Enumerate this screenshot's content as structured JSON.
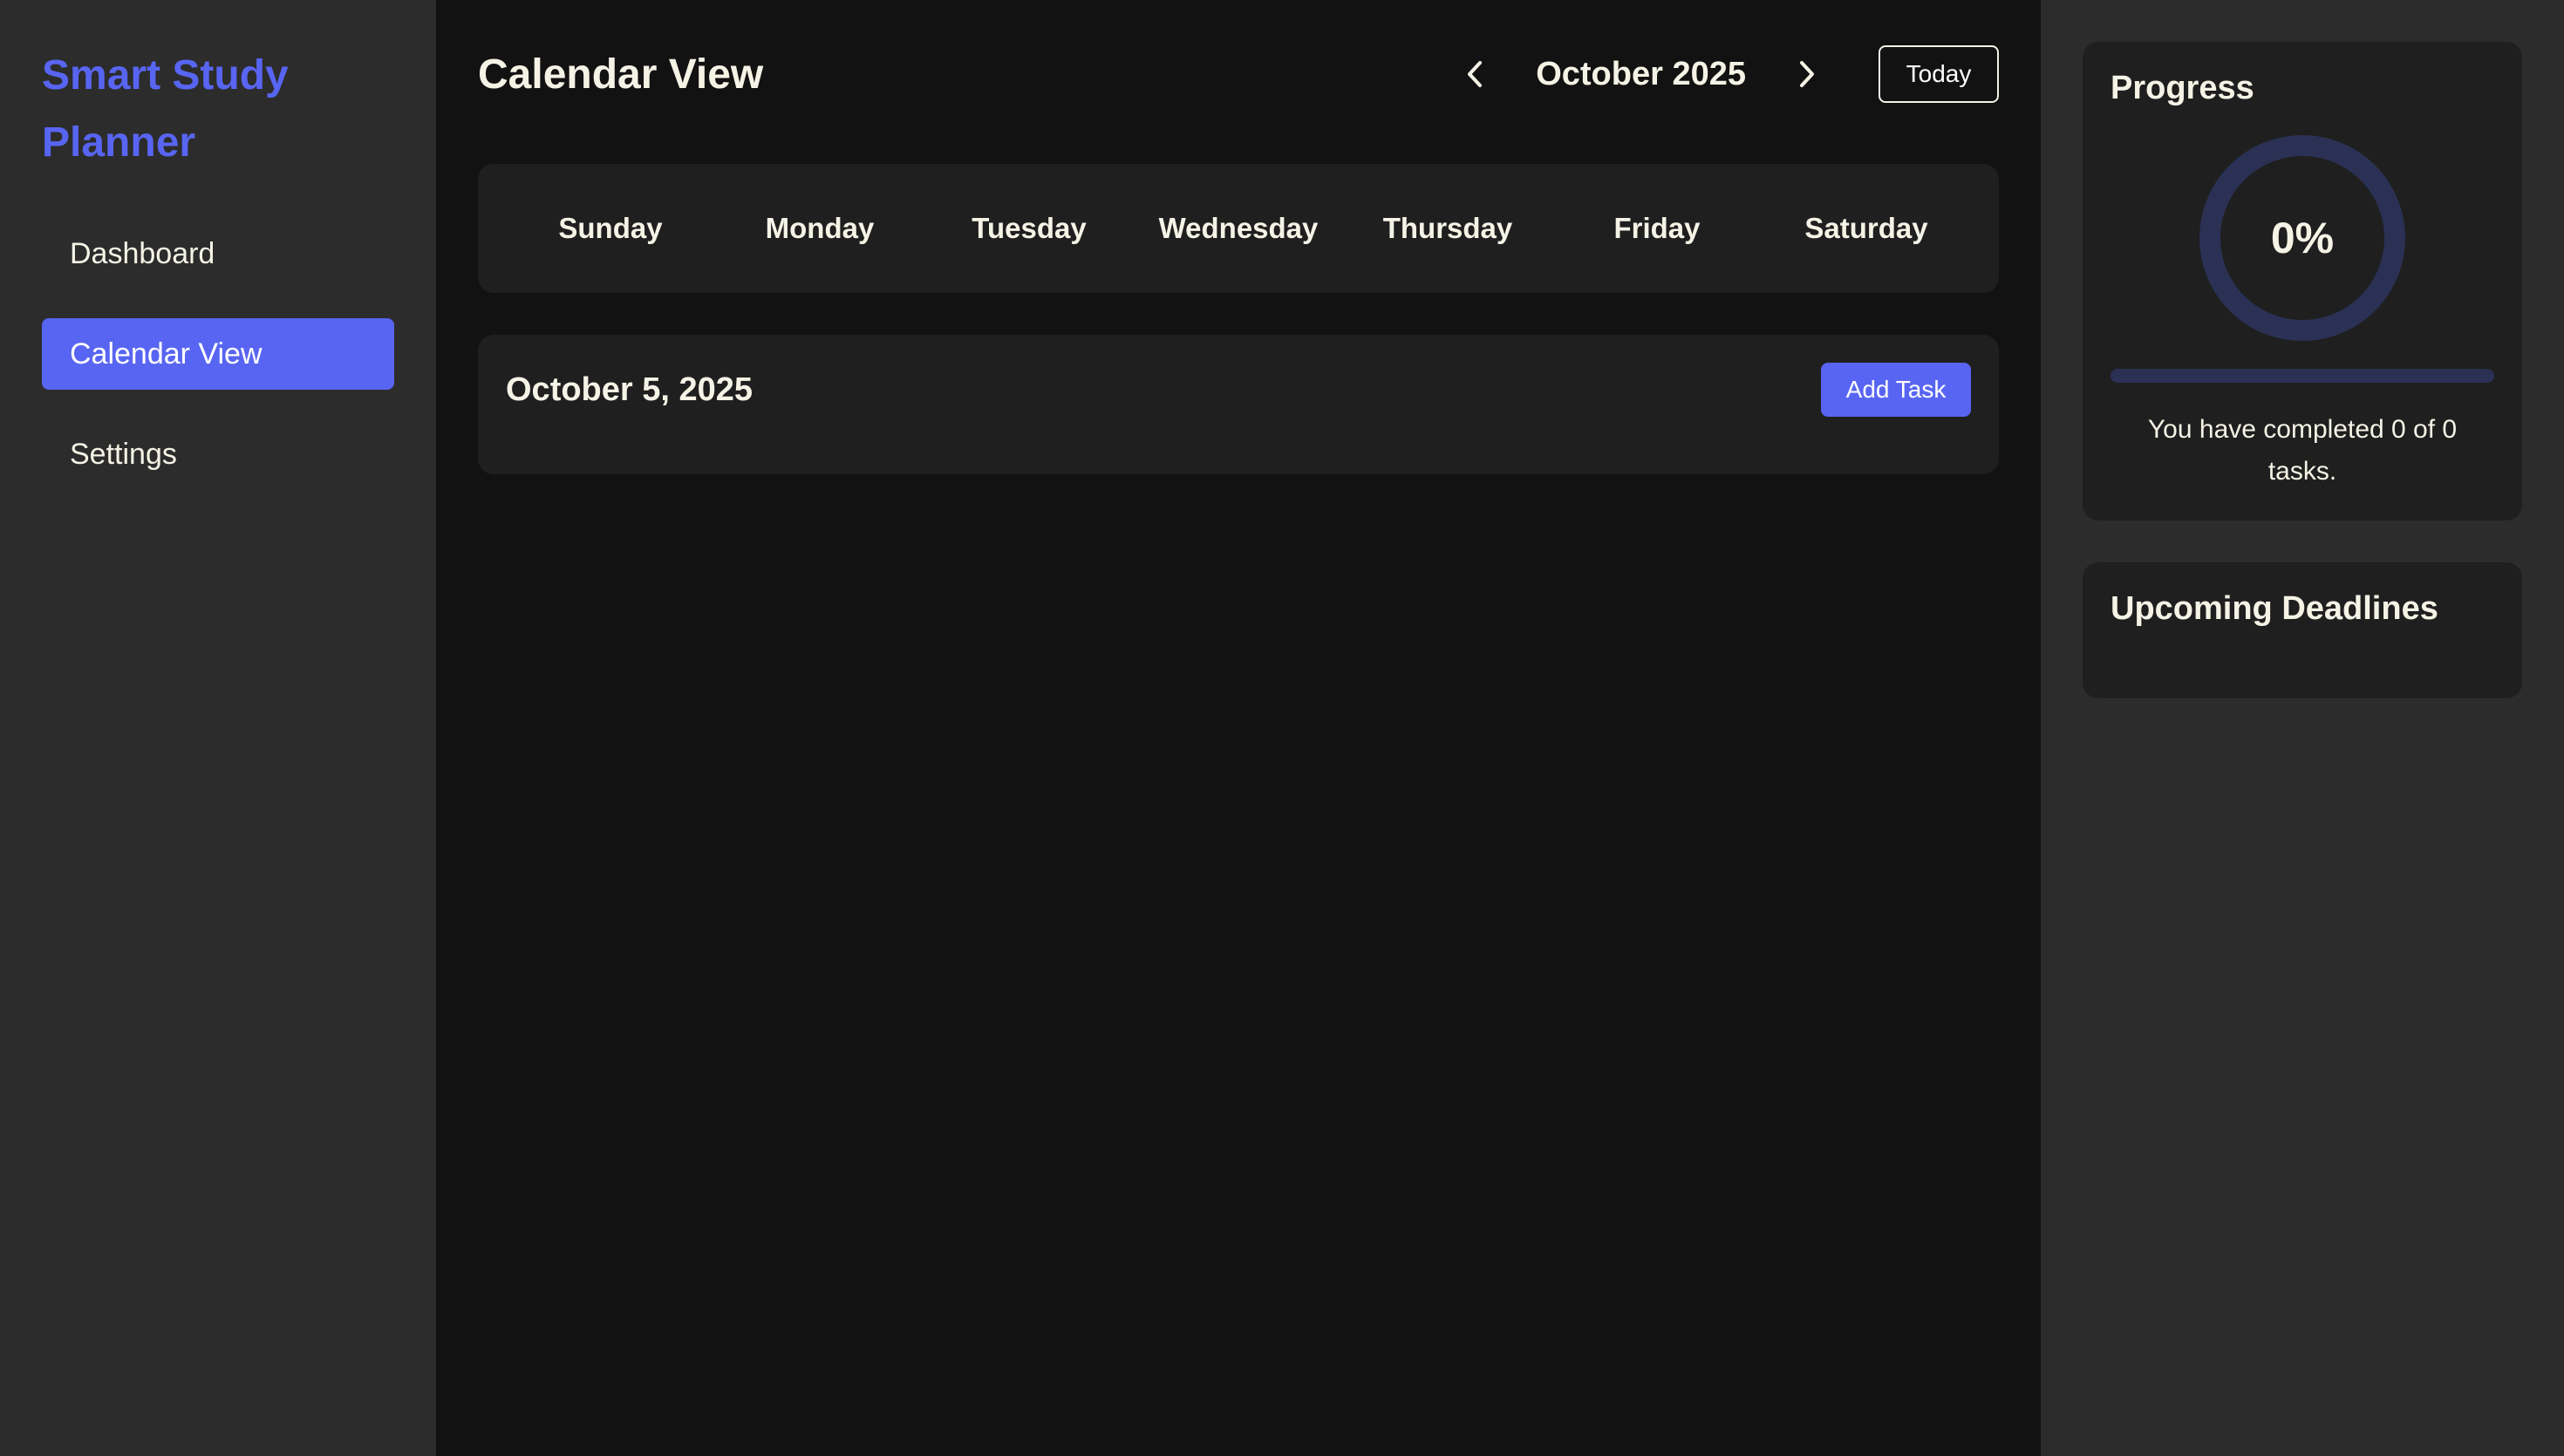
{
  "sidebar": {
    "brand": "Smart Study Planner",
    "items": [
      {
        "label": "Dashboard",
        "active": false
      },
      {
        "label": "Calendar View",
        "active": true
      },
      {
        "label": "Settings",
        "active": false
      }
    ]
  },
  "main": {
    "title": "Calendar View",
    "month_label": "October 2025",
    "prev_icon": "chevron-left-icon",
    "next_icon": "chevron-right-icon",
    "today_label": "Today",
    "weekdays": [
      "Sunday",
      "Monday",
      "Tuesday",
      "Wednesday",
      "Thursday",
      "Friday",
      "Saturday"
    ],
    "day": {
      "date_label": "October 5, 2025",
      "add_task_label": "Add Task"
    }
  },
  "progress": {
    "title": "Progress",
    "percent_label": "0%",
    "percent": 0,
    "completed_text": "You have completed 0 of 0 tasks."
  },
  "deadlines": {
    "title": "Upcoming Deadlines"
  },
  "colors": {
    "accent": "#5865f2",
    "ring_track": "#2a3154",
    "panel_bg": "#2c2c2c",
    "card_bg": "#1f1f1f",
    "main_bg": "#121212"
  }
}
